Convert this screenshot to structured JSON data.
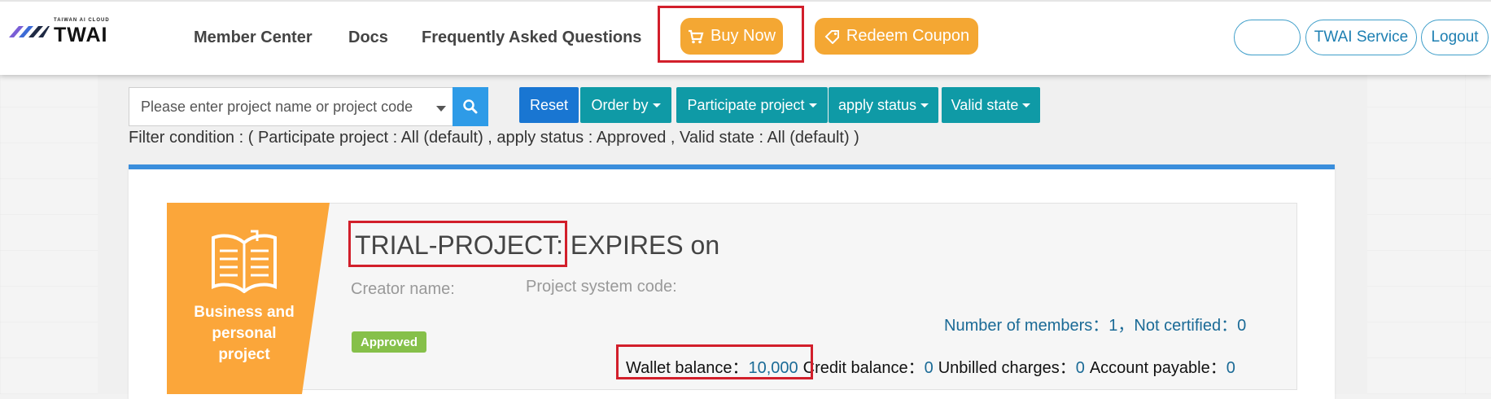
{
  "header": {
    "logo_small": "TAIWAN AI CLOUD",
    "logo_text": "TWAI",
    "nav": {
      "member_center": "Member Center",
      "docs": "Docs",
      "faq": "Frequently Asked Questions"
    },
    "buy_now": "Buy Now",
    "redeem_coupon": "Redeem Coupon",
    "blank_pill": "",
    "twai_service": "TWAI Service",
    "logout": "Logout"
  },
  "filters": {
    "search_placeholder": "Please enter project name or project code",
    "reset": "Reset",
    "order_by": "Order by",
    "participate_project": "Participate project",
    "apply_status": "apply status",
    "valid_state": "Valid state",
    "condition_text": "Filter condition : ( Participate project : All (default) , apply status : Approved , Valid state : All (default) )"
  },
  "project": {
    "category_label": "Business and personal project",
    "title_name": "TRIAL-PROJECT:",
    "title_suffix": " EXPIRES on",
    "creator_label": "Creator name:",
    "system_code_label": "Project system code:",
    "status_badge": "Approved",
    "members_label": "Number of members：",
    "members_value": "1",
    "separator": "，",
    "not_certified_label": "Not certified：",
    "not_certified_value": "0",
    "wallet_label": "Wallet balance：",
    "wallet_value": "10,000",
    "credit_label": "Credit balance：",
    "credit_value": "0",
    "unbilled_label": "Unbilled charges：",
    "unbilled_value": "0",
    "payable_label": "Account payable：",
    "payable_value": "0"
  },
  "colors": {
    "accent_orange": "#f4a733",
    "teal_button": "#0f9aa6",
    "reset_blue": "#1976d2",
    "highlight_red": "#d21f2b",
    "approved_green": "#86c04a"
  }
}
